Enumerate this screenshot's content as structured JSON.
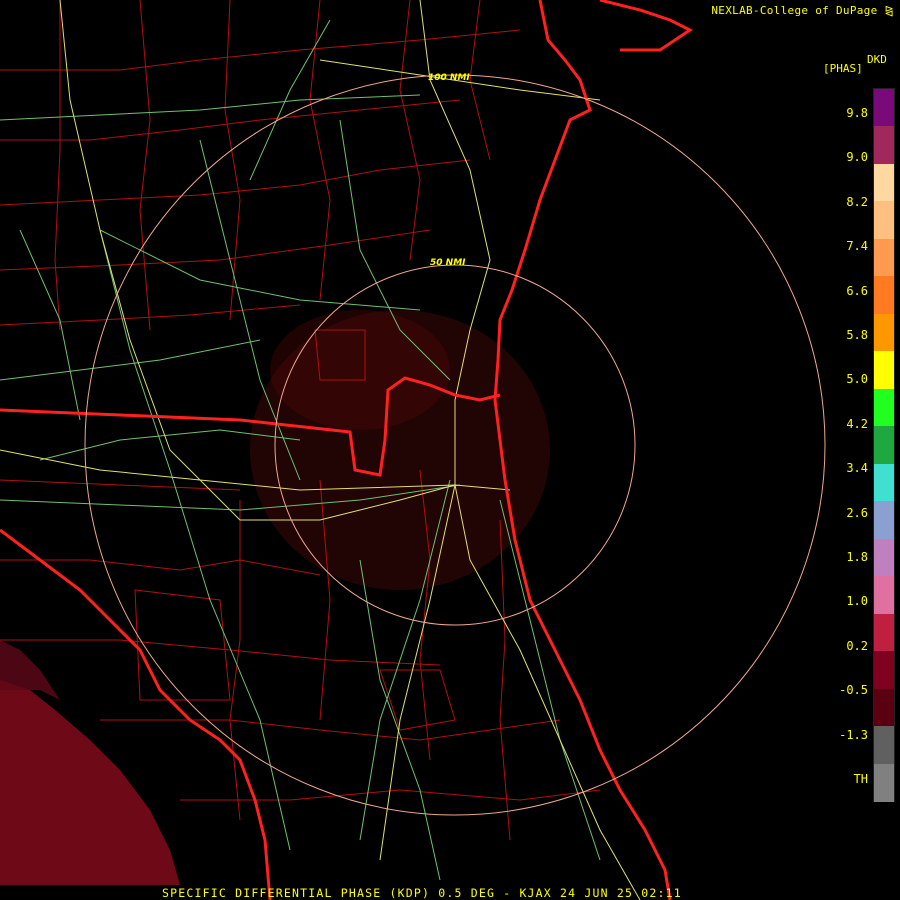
{
  "header": {
    "credit": "NEXLAB-College of DuPage",
    "credit_icon": "cod-logo-icon",
    "product_code": "DKD",
    "product_unit": "[PHAS]"
  },
  "footer": {
    "title": "SPECIFIC DIFFERENTIAL PHASE (KDP) 0.5 DEG - KJAX 24 JUN 25 02:11"
  },
  "range_rings": {
    "inner": "50 NMI",
    "outer": "100 NMI"
  },
  "color_scale": {
    "labels": [
      "9.8",
      "9.0",
      "8.2",
      "7.4",
      "6.6",
      "5.8",
      "5.0",
      "4.2",
      "3.4",
      "2.6",
      "1.8",
      "1.0",
      "0.2",
      "-0.5",
      "-1.3",
      "TH"
    ],
    "colors": [
      "#7a0a7a",
      "#a0285a",
      "#ffd7a0",
      "#ffbf80",
      "#ff9a50",
      "#ff7a20",
      "#ff9800",
      "#ffff00",
      "#20ff20",
      "#20a840",
      "#40e0d0",
      "#8aa0d0",
      "#c080c0",
      "#e070a0",
      "#c02040",
      "#800020",
      "#5a0012",
      "#606060",
      "#808080"
    ]
  },
  "colors": {
    "state_border": "#ff2020",
    "county_border": "#b01010",
    "highway": "#e0e070",
    "road": "#70c070",
    "ring": "#f0a890"
  }
}
